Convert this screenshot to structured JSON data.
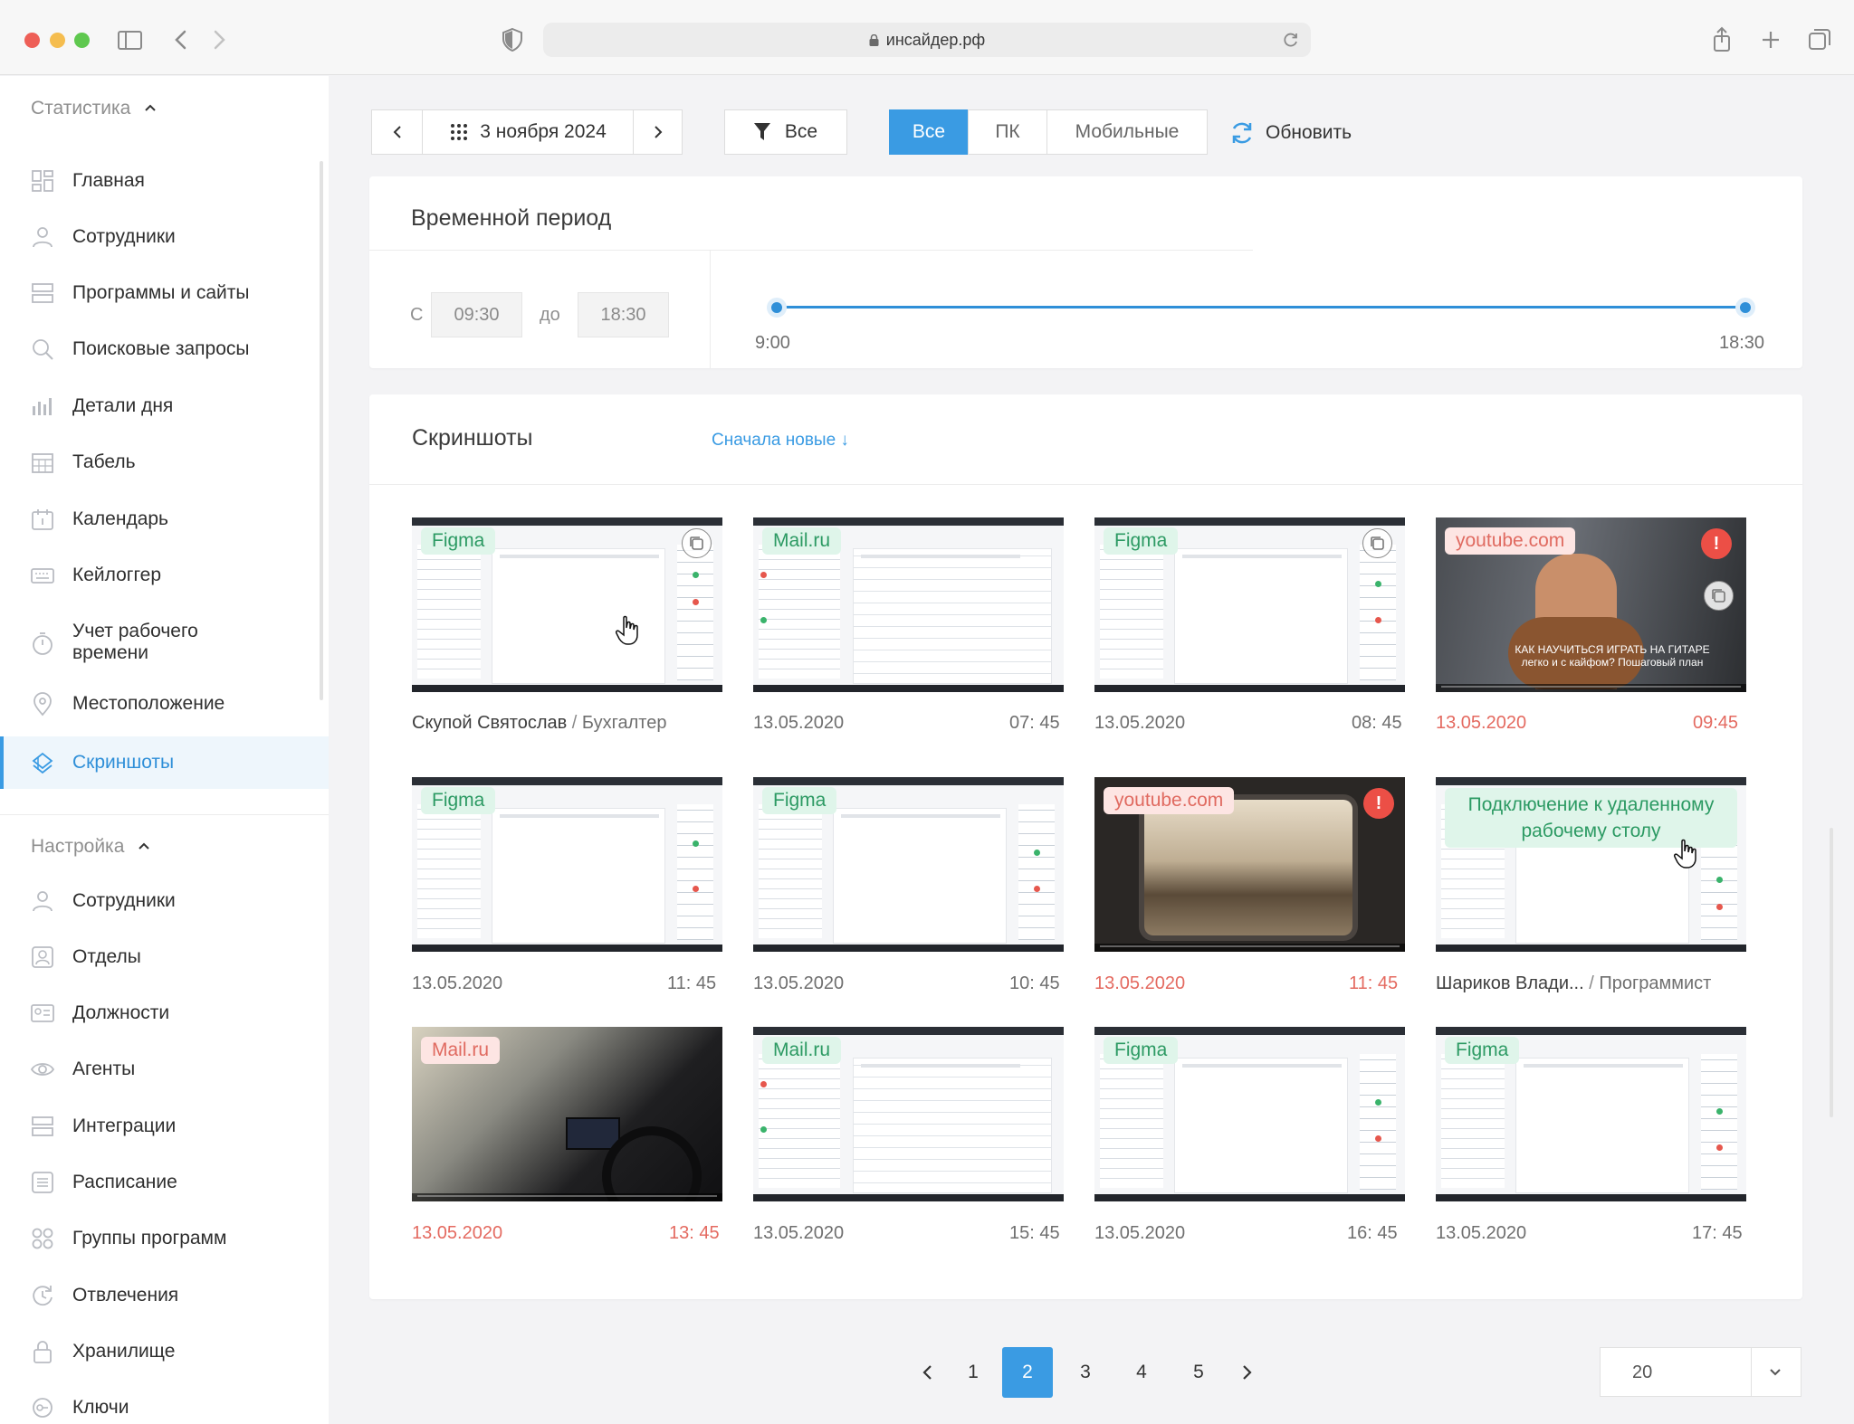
{
  "browser": {
    "url": "инсайдер.рф"
  },
  "sidebar": {
    "stats_header": "Статистика",
    "stats_items": [
      {
        "label": "Главная"
      },
      {
        "label": "Сотрудники"
      },
      {
        "label": "Программы и сайты"
      },
      {
        "label": "Поисковые запросы"
      },
      {
        "label": "Детали дня"
      },
      {
        "label": "Табель"
      },
      {
        "label": "Календарь"
      },
      {
        "label": "Кейлоггер"
      },
      {
        "label": "Учет рабочего",
        "label2": "времени"
      },
      {
        "label": "Местоположение"
      },
      {
        "label": "Скриншоты"
      }
    ],
    "settings_header": "Настройка",
    "settings_items": [
      {
        "label": "Сотрудники"
      },
      {
        "label": "Отделы"
      },
      {
        "label": "Должности"
      },
      {
        "label": "Агенты"
      },
      {
        "label": "Интеграции"
      },
      {
        "label": "Расписание"
      },
      {
        "label": "Группы программ"
      },
      {
        "label": "Отвлечения"
      },
      {
        "label": "Хранилище"
      },
      {
        "label": "Ключи"
      }
    ]
  },
  "toolbar": {
    "date": "3 ноября 2024",
    "filter_label": "Все",
    "device_tabs": [
      "Все",
      "ПК",
      "Мобильные"
    ],
    "refresh_label": "Обновить"
  },
  "time_period": {
    "title": "Временной период",
    "from_label": "С",
    "from_value": "09:30",
    "to_label": "до",
    "to_value": "18:30",
    "range_start": "9:00",
    "range_end": "18:30"
  },
  "screenshots": {
    "title": "Скриншоты",
    "sort_label": "Сначала новые ↓",
    "items": [
      {
        "tag": "Figma",
        "left": "Скупой Святослав",
        "sep": " / ",
        "right_role": "Бухгалтер",
        "time": ""
      },
      {
        "tag": "Mail.ru",
        "left": "13.05.2020",
        "time": "07: 45"
      },
      {
        "tag": "Figma",
        "left": "13.05.2020",
        "time": "08: 45"
      },
      {
        "tag": "youtube.com",
        "left": "13.05.2020",
        "time": "09:45",
        "video_caption_1": "КАК НАУЧИТЬСЯ ИГРАТЬ НА ГИТАРЕ",
        "video_caption_2": "легко и с кайфом? Пошаговый план"
      },
      {
        "tag": "Figma",
        "left": "13.05.2020",
        "time": "11: 45"
      },
      {
        "tag": "Figma",
        "left": "13.05.2020",
        "time": "10: 45"
      },
      {
        "tag": "youtube.com",
        "left": "13.05.2020",
        "time": "11: 45"
      },
      {
        "tag": "Подключение к удаленному рабочему столу",
        "left": "Шариков Влади...",
        "sep": " / ",
        "right_role": "Программист",
        "time": ""
      },
      {
        "tag": "Mail.ru",
        "left": "13.05.2020",
        "time": "13: 45"
      },
      {
        "tag": "Mail.ru",
        "left": "13.05.2020",
        "time": "15: 45"
      },
      {
        "tag": "Figma",
        "left": "13.05.2020",
        "time": "16: 45"
      },
      {
        "tag": "Figma",
        "left": "13.05.2020",
        "time": "17: 45"
      }
    ],
    "alert_symbol": "!"
  },
  "pagination": {
    "pages": [
      "1",
      "2",
      "3",
      "4",
      "5"
    ],
    "current": "2",
    "per_page": "20"
  },
  "colors": {
    "accent": "#3a9be3",
    "danger": "#e46a60",
    "tag_green": "#2c9a63",
    "tag_red": "#e06a60"
  }
}
